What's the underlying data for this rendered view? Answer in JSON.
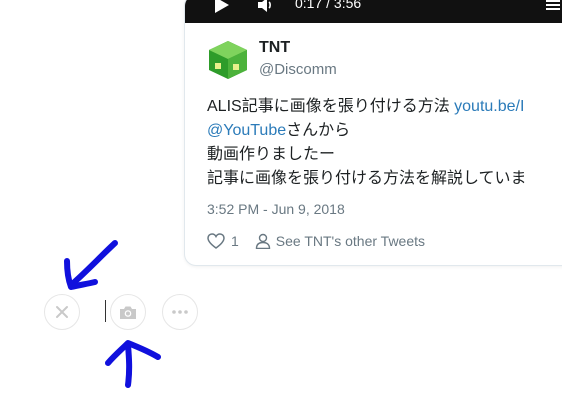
{
  "tweet": {
    "video_time": "0:17 / 3:56",
    "author_name": "TNT",
    "author_handle": "@Discomm",
    "line1_text": "ALIS記事に画像を張り付ける方法 ",
    "line1_link": "youtu.be/I",
    "line2_mention": "@YouTube",
    "line2_text": "さんから",
    "line3": "動画作りましたー",
    "line4": "記事に画像を張り付ける方法を解説していま",
    "timestamp": "3:52 PM - Jun 9, 2018",
    "like_count": "1",
    "other_tweets_label": "See TNT's other Tweets"
  },
  "colors": {
    "link": "#2b7bb9",
    "muted": "#697882",
    "annotation_arrow": "#1010dd",
    "icon_gray": "#c9c9c9"
  },
  "toolbar": {
    "icons": [
      "close-icon",
      "camera-icon",
      "more-icon"
    ]
  }
}
